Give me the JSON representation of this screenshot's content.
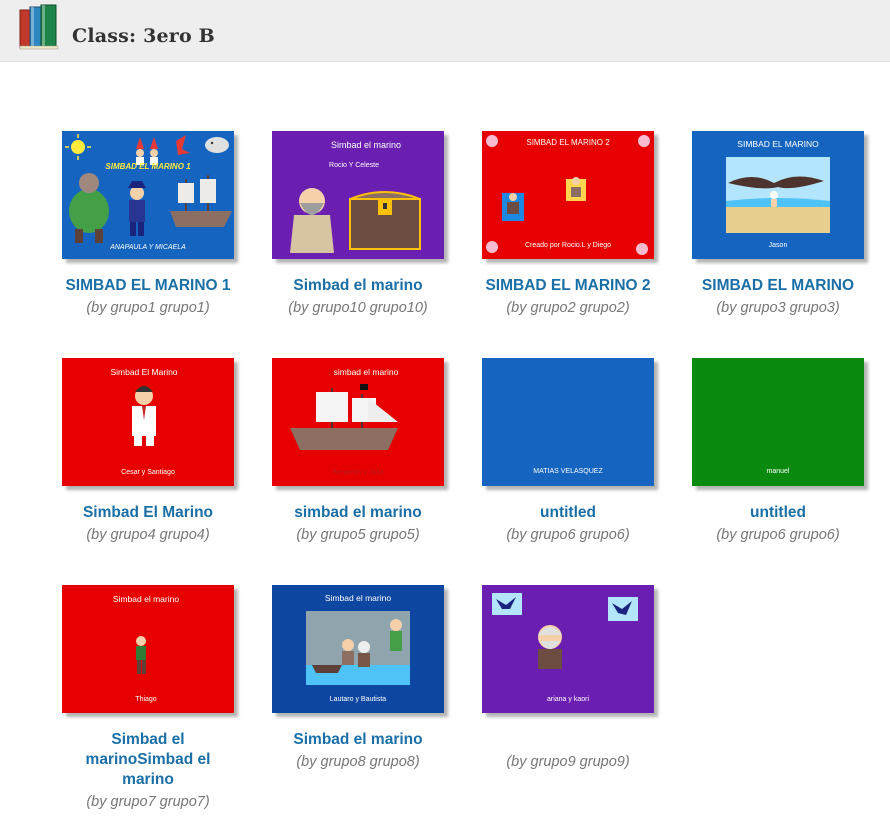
{
  "header": {
    "title": "Class: 3ero B"
  },
  "books": [
    {
      "title": "SIMBAD EL MARINO 1",
      "author": "(by grupo1 grupo1)",
      "cover_color": "#1565c0",
      "cover_heading": "SIMBAD EL MARINO 1",
      "cover_subtitle": "ANAPAULA Y MICAELA"
    },
    {
      "title": "Simbad el marino",
      "author": "(by grupo10 grupo10)",
      "cover_color": "#6a1fb0",
      "cover_heading": "Simbad el marino",
      "cover_subtitle": "Rocio Y Celeste"
    },
    {
      "title": "SIMBAD EL MARINO 2",
      "author": "(by grupo2 grupo2)",
      "cover_color": "#e60000",
      "cover_heading": "SIMBAD EL MARINO 2",
      "cover_subtitle": "Creado por Rocio.L y Diego"
    },
    {
      "title": "SIMBAD EL MARINO",
      "author": "(by grupo3 grupo3)",
      "cover_color": "#1565c0",
      "cover_heading": "SIMBAD EL MARINO",
      "cover_subtitle": "Jason"
    },
    {
      "title": "Simbad El Marino",
      "author": "(by grupo4 grupo4)",
      "cover_color": "#e60000",
      "cover_heading": "Simbad El Marino",
      "cover_subtitle": "Cesar y Santiago"
    },
    {
      "title": "simbad el marino",
      "author": "(by grupo5 grupo5)",
      "cover_color": "#e60000",
      "cover_heading": "simbad el marino",
      "cover_subtitle": "Benjamin y Julia"
    },
    {
      "title": "untitled",
      "author": "(by grupo6 grupo6)",
      "cover_color": "#1565c0",
      "cover_heading": "",
      "cover_subtitle": "MATIAS VELASQUEZ"
    },
    {
      "title": "untitled",
      "author": "(by grupo6 grupo6)",
      "cover_color": "#0b8a10",
      "cover_heading": "",
      "cover_subtitle": "manuel"
    },
    {
      "title": "Simbad el marinoSimbad el marino",
      "author": "(by grupo7 grupo7)",
      "cover_color": "#e60000",
      "cover_heading": "Simbad el marino",
      "cover_subtitle": "Thiago"
    },
    {
      "title": "Simbad el marino",
      "author": "(by grupo8 grupo8)",
      "cover_color": "#0d47a1",
      "cover_heading": "Simbad el marino",
      "cover_subtitle": "Lautaro y Bautista"
    },
    {
      "title": "",
      "author": "(by grupo9 grupo9)",
      "cover_color": "#6a1fb0",
      "cover_heading": "",
      "cover_subtitle": "ariana y kaori"
    }
  ]
}
